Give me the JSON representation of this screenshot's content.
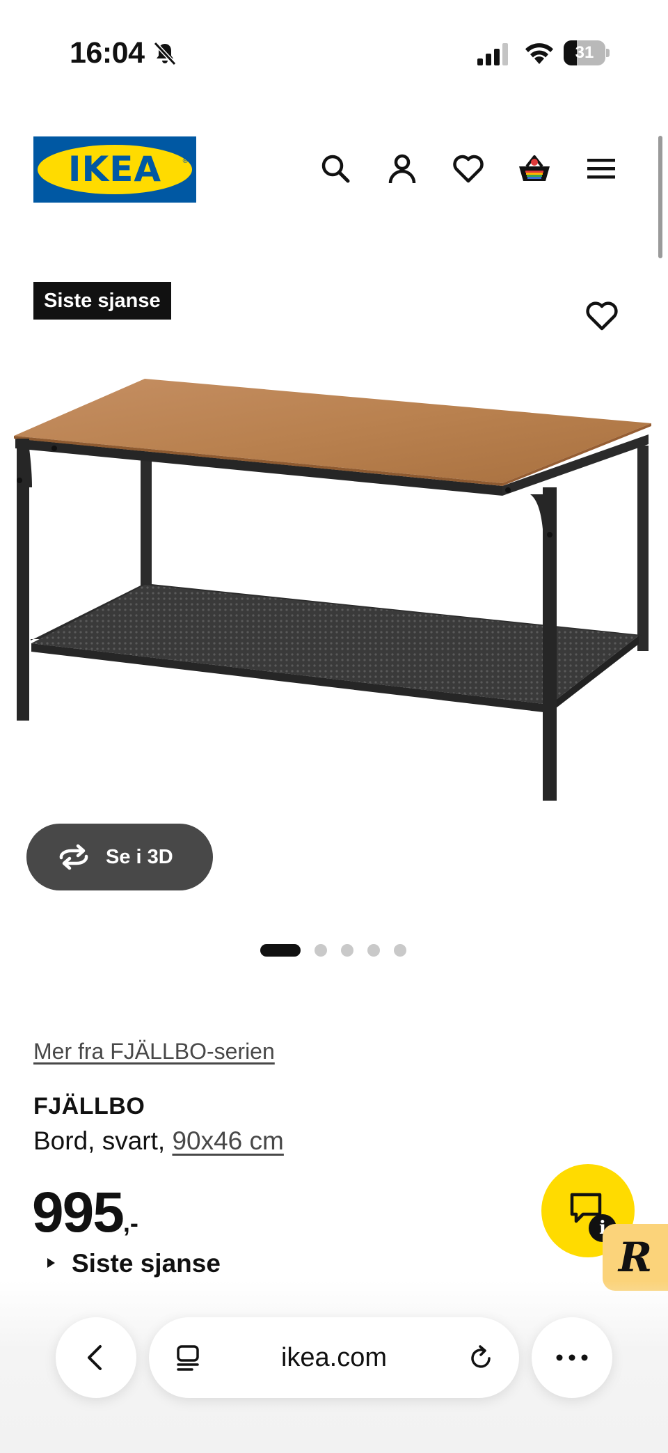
{
  "status_bar": {
    "time": "16:04",
    "battery_level": "31",
    "icons": [
      "bell-slash-icon",
      "cellular-signal-icon",
      "wifi-icon",
      "battery-icon"
    ]
  },
  "header": {
    "logo_text": "IKEA",
    "brand_colors": {
      "blue": "#0058a3",
      "yellow": "#ffdb00"
    },
    "icons": [
      "search-icon",
      "account-icon",
      "heart-icon",
      "basket-icon",
      "menu-icon"
    ]
  },
  "product": {
    "badge": "Siste sjanse",
    "see_3d_label": "Se i 3D",
    "gallery": {
      "total_images": 5,
      "active_index": 0
    },
    "series_link": "Mer fra FJÄLLBO-serien",
    "name": "FJÄLLBO",
    "description_prefix": "Bord, svart, ",
    "size_link": "90x46 cm",
    "price": "995",
    "price_suffix": ",-",
    "availability": "Siste sjanse"
  },
  "chat": {
    "info_glyph": "i",
    "badge_letter": "R"
  },
  "browser_bar": {
    "domain": "ikea.com",
    "icons": [
      "back-chevron-icon",
      "tabs-icon",
      "reload-icon",
      "more-icon"
    ]
  }
}
